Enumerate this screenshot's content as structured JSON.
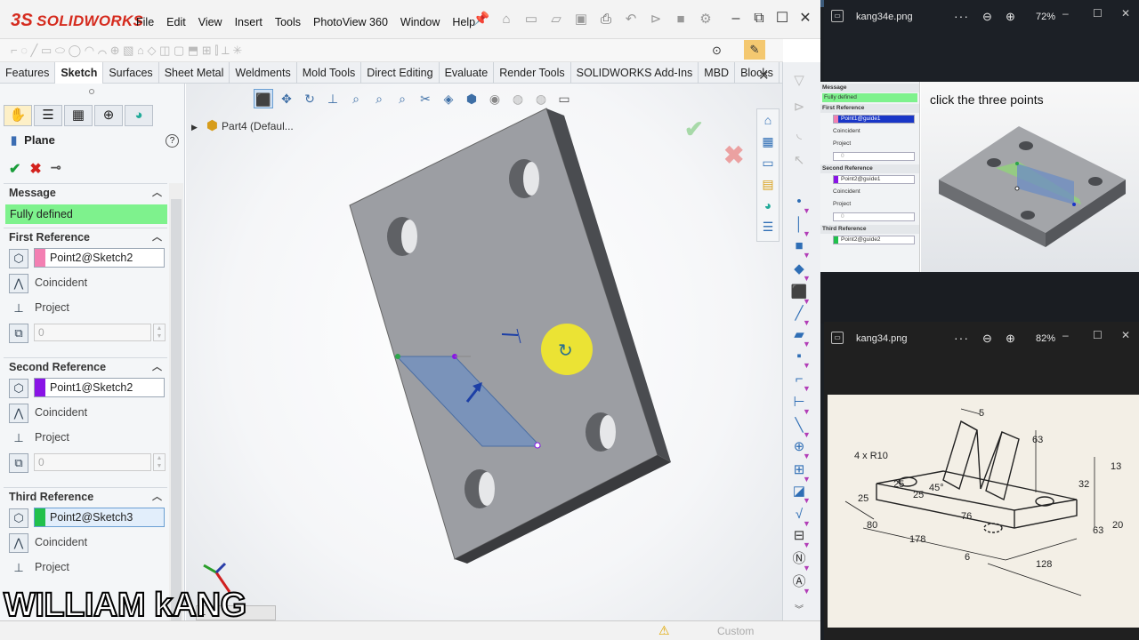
{
  "app": {
    "brand": "SOLIDWORKS",
    "brand_mark": "3S",
    "menu": [
      "File",
      "Edit",
      "View",
      "Insert",
      "Tools",
      "PhotoView 360",
      "Window",
      "Help"
    ],
    "tabs": [
      "Features",
      "Sketch",
      "Surfaces",
      "Sheet Metal",
      "Weldments",
      "Mold Tools",
      "Direct Editing",
      "Evaluate",
      "Render Tools",
      "SOLIDWORKS Add-Ins",
      "MBD",
      "Blocks"
    ],
    "active_tab": "Sketch"
  },
  "property_manager": {
    "title": "Plane",
    "help": "?",
    "message_header": "Message",
    "message": "Fully defined",
    "first_reference": {
      "header": "First Reference",
      "value": "Point2@Sketch2",
      "color": "#f37fb2",
      "option1": "Coincident",
      "option2": "Project",
      "offset": "0"
    },
    "second_reference": {
      "header": "Second Reference",
      "value": "Point1@Sketch2",
      "color": "#8a14e6",
      "option1": "Coincident",
      "option2": "Project",
      "offset": "0"
    },
    "third_reference": {
      "header": "Third Reference",
      "value": "Point2@Sketch3",
      "color": "#21c04c",
      "option1": "Coincident",
      "option2": "Project"
    }
  },
  "graphics": {
    "tree_node": "Part4  (Defaul..."
  },
  "status": {
    "custom": "Custom",
    "model_tab": "1"
  },
  "watermark": "WILLIAM kANG",
  "viewer1": {
    "filename": "kang34e.png",
    "dots": "···",
    "zoom": "72%",
    "caption": "click the three points",
    "mini": {
      "message": "Message",
      "defined": "Fully defined",
      "first": "First Reference",
      "first_val": "Point1@guide1",
      "coincident": "Coincident",
      "project": "Project",
      "zero": "0",
      "second": "Second Reference",
      "second_val": "Point2@guide1",
      "third": "Third Reference",
      "third_val": "Point2@guide2"
    }
  },
  "viewer2": {
    "filename": "kang34.png",
    "dots": "···",
    "zoom": "82%",
    "dims": {
      "d5": "5",
      "d63": "63",
      "r10": "4 x  R10",
      "d13": "13",
      "d25a": "25",
      "d25b": "25",
      "d45": "45°",
      "d32": "32",
      "d76": "76",
      "d25c": "25",
      "d80": "80",
      "d178": "178",
      "d63b": "63",
      "d20": "20",
      "d6": "6",
      "d128": "128"
    }
  }
}
